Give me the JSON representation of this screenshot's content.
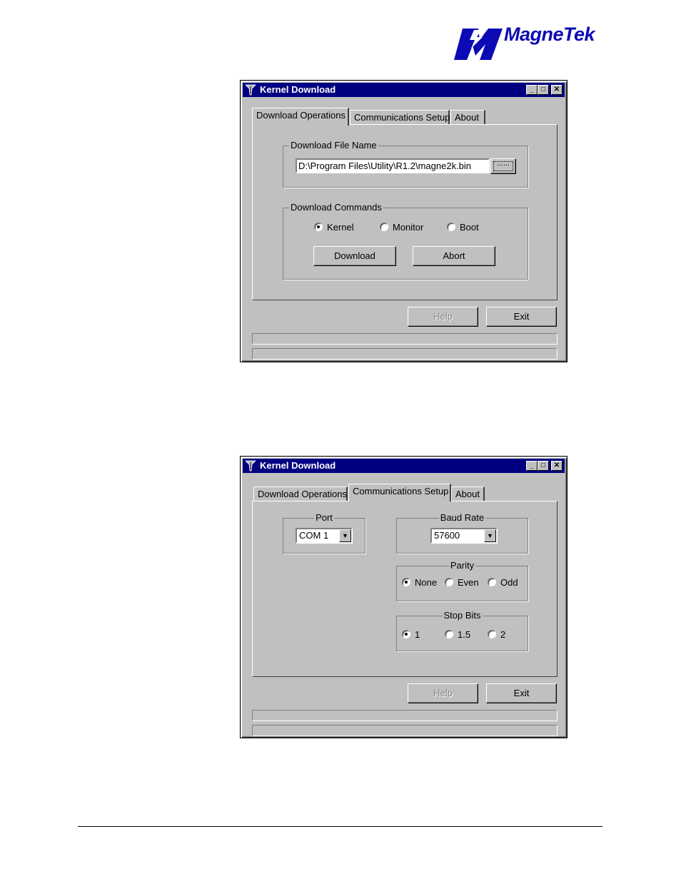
{
  "logo": {
    "text": "MagneTek",
    "color": "#0b0bb5"
  },
  "window1": {
    "title": "Kernel Download",
    "tabs": [
      "Download Operations",
      "Communications Setup",
      "About"
    ],
    "file_group_label": "Download File Name",
    "file_path": "D:\\Program Files\\Utility\\R1.2\\magne2k.bin",
    "browse_label": "......",
    "commands_group_label": "Download Commands",
    "radios": [
      "Kernel",
      "Monitor",
      "Boot"
    ],
    "download_button": "Download",
    "abort_button": "Abort",
    "help_button": "Help",
    "exit_button": "Exit"
  },
  "window2": {
    "title": "Kernel Download",
    "tabs": [
      "Download Operations",
      "Communications Setup",
      "About"
    ],
    "port_label": "Port",
    "port_value": "COM 1",
    "baud_label": "Baud Rate",
    "baud_value": "57600",
    "parity_label": "Parity",
    "parity_options": [
      "None",
      "Even",
      "Odd"
    ],
    "stopbits_label": "Stop Bits",
    "stopbits_options": [
      "1",
      "1.5",
      "2"
    ],
    "help_button": "Help",
    "exit_button": "Exit"
  },
  "colors": {
    "titlebar": "#000080",
    "face": "#c0c0c0"
  }
}
